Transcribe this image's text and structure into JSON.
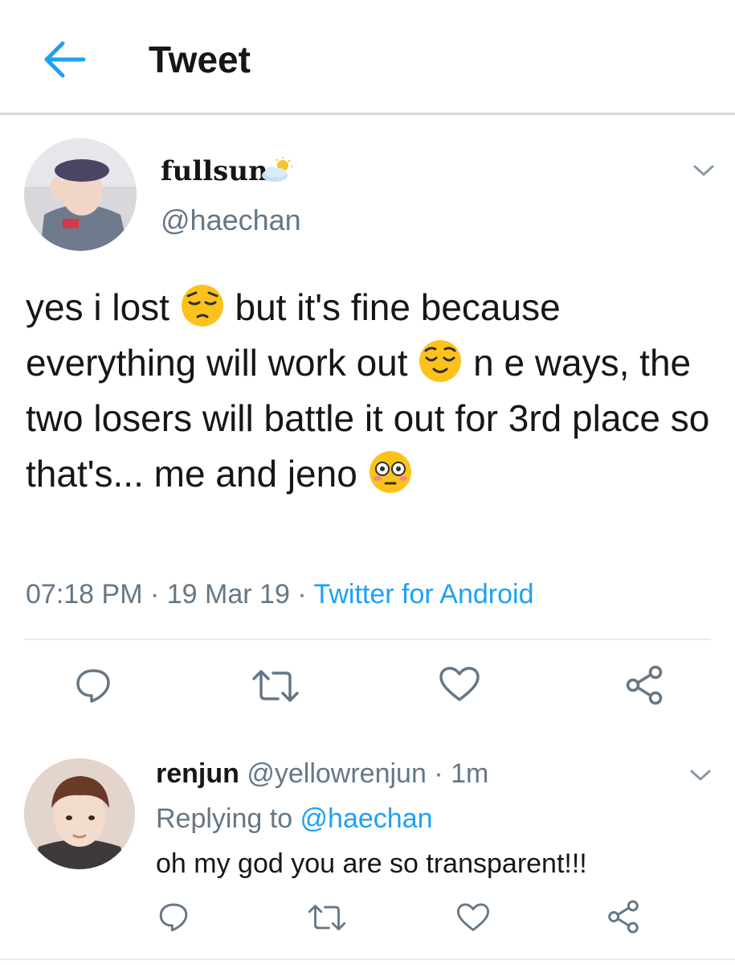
{
  "header": {
    "title": "Tweet",
    "back_icon": "arrow-left-icon",
    "accent_color": "#1da1f2"
  },
  "tweet": {
    "display_name": "fullsun",
    "name_emoji": "sun-behind-cloud-icon",
    "handle": "@haechan",
    "text_parts": [
      "yes i lost ",
      " but it's fine because everything will work out ",
      " n e ways, the two losers will battle it out for 3rd place so that's... me and jeno "
    ],
    "emojis": [
      "pensive-face-icon",
      "relieved-face-icon",
      "flushed-face-icon"
    ],
    "time": "07:18 PM",
    "date": "19 Mar 19",
    "separator": "·",
    "source": "Twitter for Android",
    "actions": [
      "reply-icon",
      "retweet-icon",
      "like-icon",
      "share-icon"
    ]
  },
  "reply": {
    "display_name": "renjun",
    "handle": "@yellowrenjun",
    "separator": "·",
    "time": "1m",
    "replying_prefix": "Replying to ",
    "replying_to": "@haechan",
    "text": "oh my god you are so transparent!!!"
  }
}
